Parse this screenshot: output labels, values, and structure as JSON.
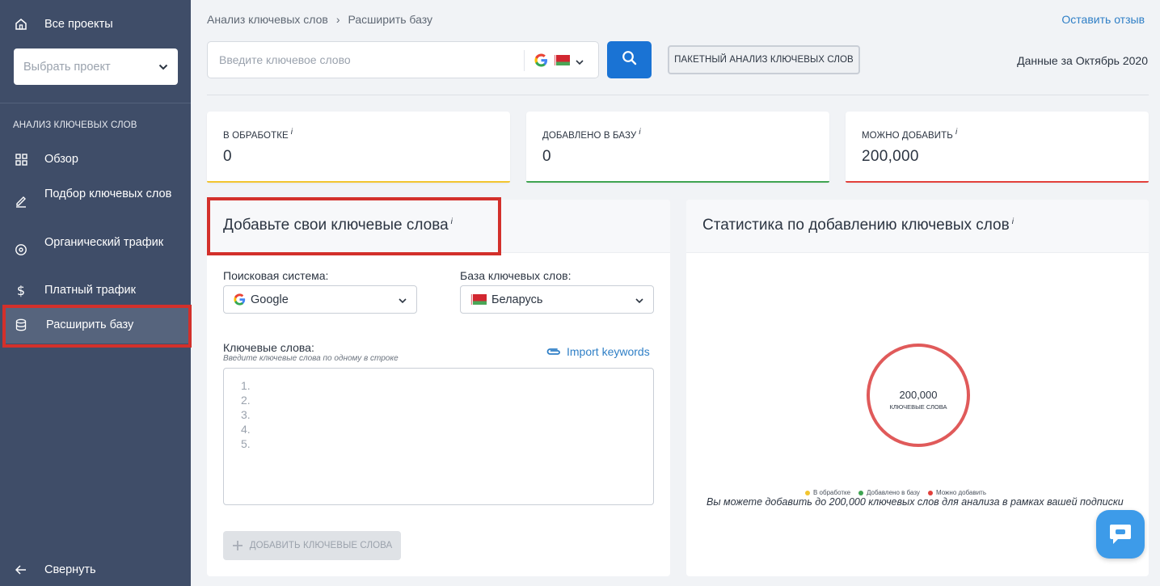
{
  "sidebar": {
    "all_projects": "Все проекты",
    "project_select_placeholder": "Выбрать проект",
    "section_title": "АНАЛИЗ КЛЮЧЕВЫХ СЛОВ",
    "items": [
      {
        "label": "Обзор",
        "icon": "grid-icon"
      },
      {
        "label": "Подбор ключевых слов",
        "icon": "pencil-icon"
      },
      {
        "label": "Органический трафик",
        "icon": "target-icon"
      },
      {
        "label": "Платный трафик",
        "icon": "dollar-icon"
      },
      {
        "label": "Расширить базу",
        "icon": "database-icon",
        "active": true
      }
    ],
    "collapse": "Свернуть"
  },
  "header": {
    "breadcrumb": [
      "Анализ ключевых слов",
      "Расширить базу"
    ],
    "breadcrumb_sep": "›",
    "feedback_link": "Оставить отзыв",
    "search_placeholder": "Введите ключевое слово",
    "batch_button": "ПАКЕТНЫЙ АНАЛИЗ КЛЮЧЕВЫХ СЛОВ",
    "data_date": "Данные за Октябрь 2020"
  },
  "stats": [
    {
      "title": "В ОБРАБОТКЕ",
      "info": "i",
      "value": "0",
      "color": "#f2c530"
    },
    {
      "title": "ДОБАВЛЕНО В БАЗУ",
      "info": "i",
      "value": "0",
      "color": "#3fa452"
    },
    {
      "title": "МОЖНО ДОБАВИТЬ",
      "info": "i",
      "value": "200,000",
      "color": "#e2403b"
    }
  ],
  "add_panel": {
    "title": "Добавьте свои ключевые слова",
    "info": "i",
    "engine_label": "Поисковая система:",
    "engine_value": "Google",
    "db_label": "База ключевых слов:",
    "db_value": "Беларусь",
    "keywords_label": "Ключевые слова:",
    "keywords_hint": "Введите ключевые слова по одному в строке",
    "import_link": "Import keywords",
    "line_numbers": [
      "1.",
      "2.",
      "3.",
      "4.",
      "5."
    ],
    "add_button": "ДОБАВИТЬ КЛЮЧЕВЫЕ СЛОВА"
  },
  "stats_panel": {
    "title": "Статистика по добавлению ключевых слов",
    "info": "i",
    "total_value": "200,000",
    "total_label": "КЛЮЧЕВЫЕ СЛОВА",
    "legend": [
      {
        "label": "В обработке",
        "color": "#f2c530"
      },
      {
        "label": "Добавлено в базу",
        "color": "#3fa452"
      },
      {
        "label": "Можно добавить",
        "color": "#e2403b"
      }
    ],
    "note": "Вы можете добавить до 200,000 ключевых слов для анализа в рамках вашей подписки"
  },
  "colors": {
    "sidebar_bg": "#3f4d68",
    "accent_blue": "#1a73d4",
    "highlight_red": "#d3302b",
    "donut_red": "#e05a5a"
  }
}
